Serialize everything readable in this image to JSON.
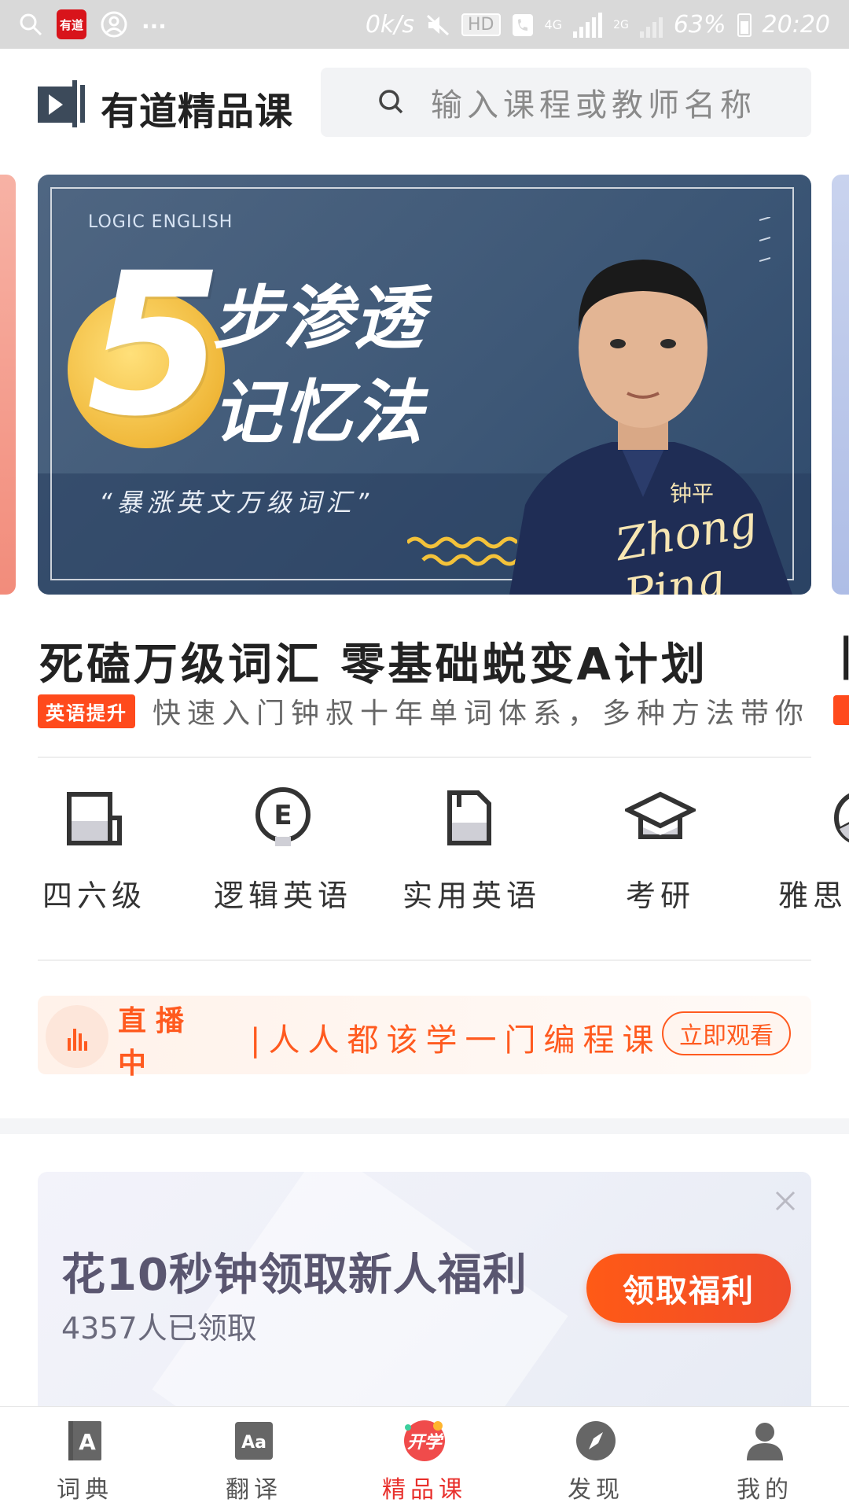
{
  "status_bar": {
    "app_icon_text": "有道",
    "more_dots": "...",
    "net_speed": "0k/s",
    "hd_badge": "HD",
    "net_4g": "4G",
    "net_2g": "2G",
    "battery_percent": "63%",
    "time": "20:20"
  },
  "header": {
    "app_name": "有道精品课",
    "search_placeholder": "输入课程或教师名称"
  },
  "banner": {
    "eyebrow": "LOGIC ENGLISH",
    "big_number": "5",
    "headline_line1": "步渗透",
    "headline_line2": "记忆法",
    "quote": "“暴涨英文万级词汇”",
    "teacher_name_cn": "钟平",
    "teacher_name_en": "Zhong Ping"
  },
  "featured_course": {
    "title": "死磕万级词汇 零基础蜕变A计划",
    "tag": "英语提升",
    "description": "快速入门钟叔十年单词体系，多种方法带你"
  },
  "categories": [
    {
      "label": "四六级",
      "icon": "book-icon"
    },
    {
      "label": "逻辑英语",
      "icon": "e-bulb-icon"
    },
    {
      "label": "实用英语",
      "icon": "folder-icon"
    },
    {
      "label": "考研",
      "icon": "graduation-cap-icon"
    },
    {
      "label": "雅思",
      "icon": "pie-icon"
    }
  ],
  "live": {
    "status": "直播中",
    "text": "|人人都该学一门编程课",
    "button": "立即观看"
  },
  "promo": {
    "title": "花10秒钟领取新人福利",
    "subtitle": "4357人已领取",
    "button": "领取福利"
  },
  "bottom_nav": [
    {
      "label": "词典",
      "icon": "dictionary-icon",
      "active": false
    },
    {
      "label": "翻译",
      "icon": "translate-icon",
      "active": false
    },
    {
      "label": "精品课",
      "icon": "kaixue-icon",
      "badge": "开学",
      "active": true
    },
    {
      "label": "发现",
      "icon": "compass-icon",
      "active": false
    },
    {
      "label": "我的",
      "icon": "profile-icon",
      "active": false
    }
  ],
  "colors": {
    "accent": "#ff5a1f",
    "tag_red": "#ff4a1c",
    "active_nav": "#e8302c",
    "banner_bg": "#3e5877"
  }
}
